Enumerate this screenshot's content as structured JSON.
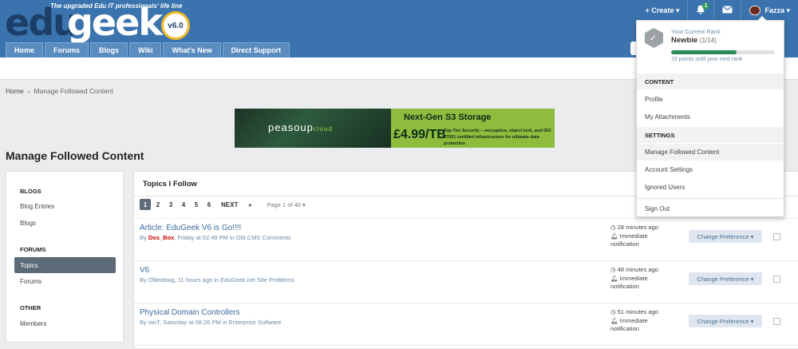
{
  "header": {
    "tagline": "The upgraded Edu IT professionals' life line",
    "logo_part1": "edu",
    "logo_part2": "geek",
    "version": "v6.0"
  },
  "nav": [
    {
      "label": "Home"
    },
    {
      "label": "Forums"
    },
    {
      "label": "Blogs"
    },
    {
      "label": "Wiki"
    },
    {
      "label": "What's New"
    },
    {
      "label": "Direct Support"
    }
  ],
  "top_actions": {
    "create_label": "+ Create ▾",
    "notifications_count": "1",
    "user_name": "Fazza ▾"
  },
  "breadcrumb": {
    "home": "Home",
    "sep": "›",
    "current": "Manage Followed Content"
  },
  "banner": {
    "brand": "peasoup",
    "brand_suffix": "cloud",
    "title": "Next-Gen S3 Storage",
    "price": "£4.99/TB",
    "description": "Top-Tier Security – encryption, object lock, and ISO 27001 certified infrastructure for ultimate data protection"
  },
  "page_title": "Manage Followed Content",
  "sidebar": {
    "sections": [
      {
        "heading": "BLOGS",
        "items": [
          "Blog Entries",
          "Blogs"
        ]
      },
      {
        "heading": "FORUMS",
        "items": [
          "Topics",
          "Forums"
        ]
      },
      {
        "heading": "OTHER",
        "items": [
          "Members"
        ]
      }
    ],
    "active_item": "Topics"
  },
  "content": {
    "title": "Topics I Follow",
    "pager": {
      "pages": [
        "1",
        "2",
        "3",
        "4",
        "5",
        "6"
      ],
      "next": "NEXT",
      "last": "»",
      "page_of": "Page 1 of 40 ▾"
    },
    "rows": [
      {
        "title": "Article: EduGeek V6 is Go!!!!",
        "by": "By ",
        "user": "Dos_Box",
        "meta": ", Friday at 02:49 PM in Old CMS Comments",
        "time": "28 minutes ago",
        "notification": "Immediate notification",
        "pref_label": "Change Preference ▾"
      },
      {
        "title": "V6",
        "by": "By ",
        "user": "",
        "meta": "Olliedawg, 11 hours ago in EduGeek.net Site Problems",
        "time": "48 minutes ago",
        "notification": "Immediate notification",
        "pref_label": "Change Preference ▾"
      },
      {
        "title": "Physical Domain Controllers",
        "by": "By ",
        "user": "",
        "meta": "IanT, Saturday at 08:26 PM in Enterprise Software",
        "time": "51 minutes ago",
        "notification": "Immediate notification",
        "pref_label": "Change Preference ▾"
      }
    ]
  },
  "dropdown": {
    "rank_label": "Your Current Rank",
    "rank_name": "Newbie",
    "rank_fraction": "(1/14)",
    "rank_progress": 0.63,
    "rank_next": "15 points until your next rank",
    "content_heading": "CONTENT",
    "content_items": [
      "Profile",
      "My Attachments"
    ],
    "settings_heading": "SETTINGS",
    "settings_items": [
      "Manage Followed Content",
      "Account Settings",
      "Ignored Users"
    ],
    "sign_out": "Sign Out"
  },
  "colors": {
    "header_bg": "#3a73ad",
    "nav_item": "#5a8cc0",
    "active_item": "#5d6a78",
    "link": "#3a6a9a",
    "username_red": "#cc0000",
    "rank_bar": "#2a8a5a",
    "banner_green": "#8ebd3e"
  }
}
